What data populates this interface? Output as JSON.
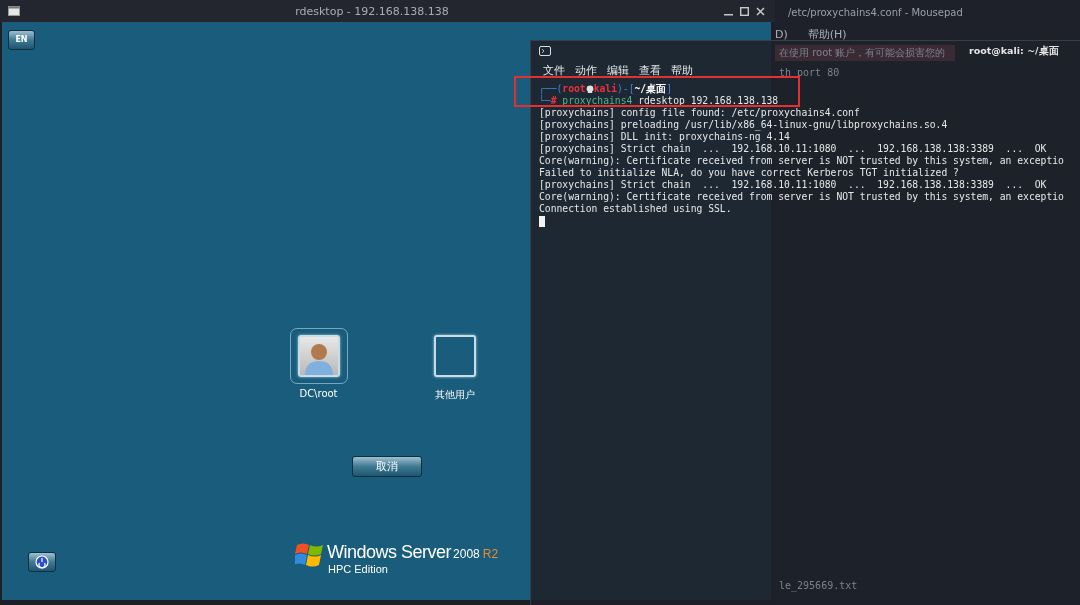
{
  "rdesktop_window": {
    "title": "rdesktop - 192.168.138.138"
  },
  "login_screen": {
    "language_button": "EN",
    "users": [
      {
        "name": "DC\\root",
        "kind": "avatar",
        "selected": true
      },
      {
        "name": "其他用户",
        "kind": "blank",
        "selected": false
      }
    ],
    "cancel_button": "取消",
    "logo": {
      "product": "Windows Server",
      "version": "2008",
      "release": "R2",
      "edition": "HPC Edition"
    }
  },
  "mousepad_window": {
    "title": "/etc/proxychains4.conf - Mousepad",
    "menu": [
      "D)",
      "帮助(H)"
    ],
    "faint_lines": [
      "在使用 root 账户，有可能会损害您的",
      "th port 80"
    ],
    "faint_footer": "le_295669.txt"
  },
  "terminal_window": {
    "title": "root@kali: ~/桌面",
    "menu": [
      "文件",
      "动作",
      "编辑",
      "查看",
      "帮助"
    ],
    "prompt": {
      "open": "┌──(",
      "user": "root",
      "host": "kali",
      "mid": ")-[",
      "path": "~/桌面",
      "close": "]",
      "corner": "└─",
      "symbol": "#",
      "command": "proxychains4",
      "args": " rdesktop 192.168.138.138"
    },
    "output": [
      "[proxychains] config file found: /etc/proxychains4.conf",
      "[proxychains] preloading /usr/lib/x86_64-linux-gnu/libproxychains.so.4",
      "[proxychains] DLL init: proxychains-ng 4.14",
      "[proxychains] Strict chain  ...  192.168.10.11:1080  ...  192.168.138.138:3389  ...  OK",
      "Core(warning): Certificate received from server is NOT trusted by this system, an exceptio",
      "Failed to initialize NLA, do you have correct Kerberos TGT initialized ?",
      "[proxychains] Strict chain  ...  192.168.10.11:1080  ...  192.168.138.138:3389  ...  OK",
      "Core(warning): Certificate received from server is NOT trusted by this system, an exceptio",
      "Connection established using SSL."
    ]
  }
}
